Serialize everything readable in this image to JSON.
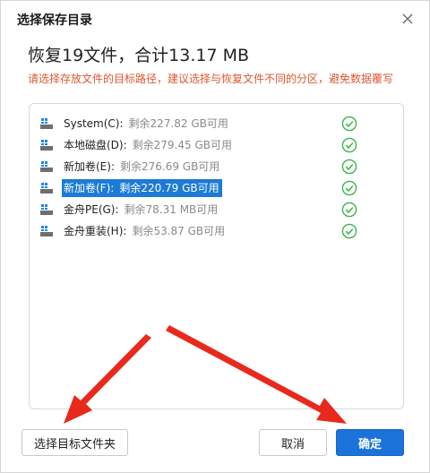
{
  "dialog": {
    "title": "选择保存目录",
    "headline": "恢复19文件，合计13.17 MB",
    "hint": "请选择存放文件的目标路径，建议选择与恢复文件不同的分区，避免数据覆写"
  },
  "drives": [
    {
      "name": "System(C):",
      "free": "剩余227.82 GB可用",
      "selected": false
    },
    {
      "name": "本地磁盘(D):",
      "free": "剩余279.45 GB可用",
      "selected": false
    },
    {
      "name": "新加卷(E):",
      "free": "剩余276.69 GB可用",
      "selected": false
    },
    {
      "name": "新加卷(F):",
      "free": "剩余220.79 GB可用",
      "selected": true
    },
    {
      "name": "金舟PE(G):",
      "free": "剩余78.31 MB可用",
      "selected": false
    },
    {
      "name": "金舟重装(H):",
      "free": "剩余53.87 GB可用",
      "selected": false
    }
  ],
  "buttons": {
    "choose_folder": "选择目标文件夹",
    "cancel": "取消",
    "ok": "确定"
  },
  "icons": {
    "close": "close-icon",
    "drive": "windows-drive-icon",
    "check": "check-circle-icon"
  },
  "colors": {
    "accent": "#1b72d8",
    "hint": "#e0562e",
    "check": "#3bb54a",
    "annotation_arrow": "#e8291c"
  }
}
